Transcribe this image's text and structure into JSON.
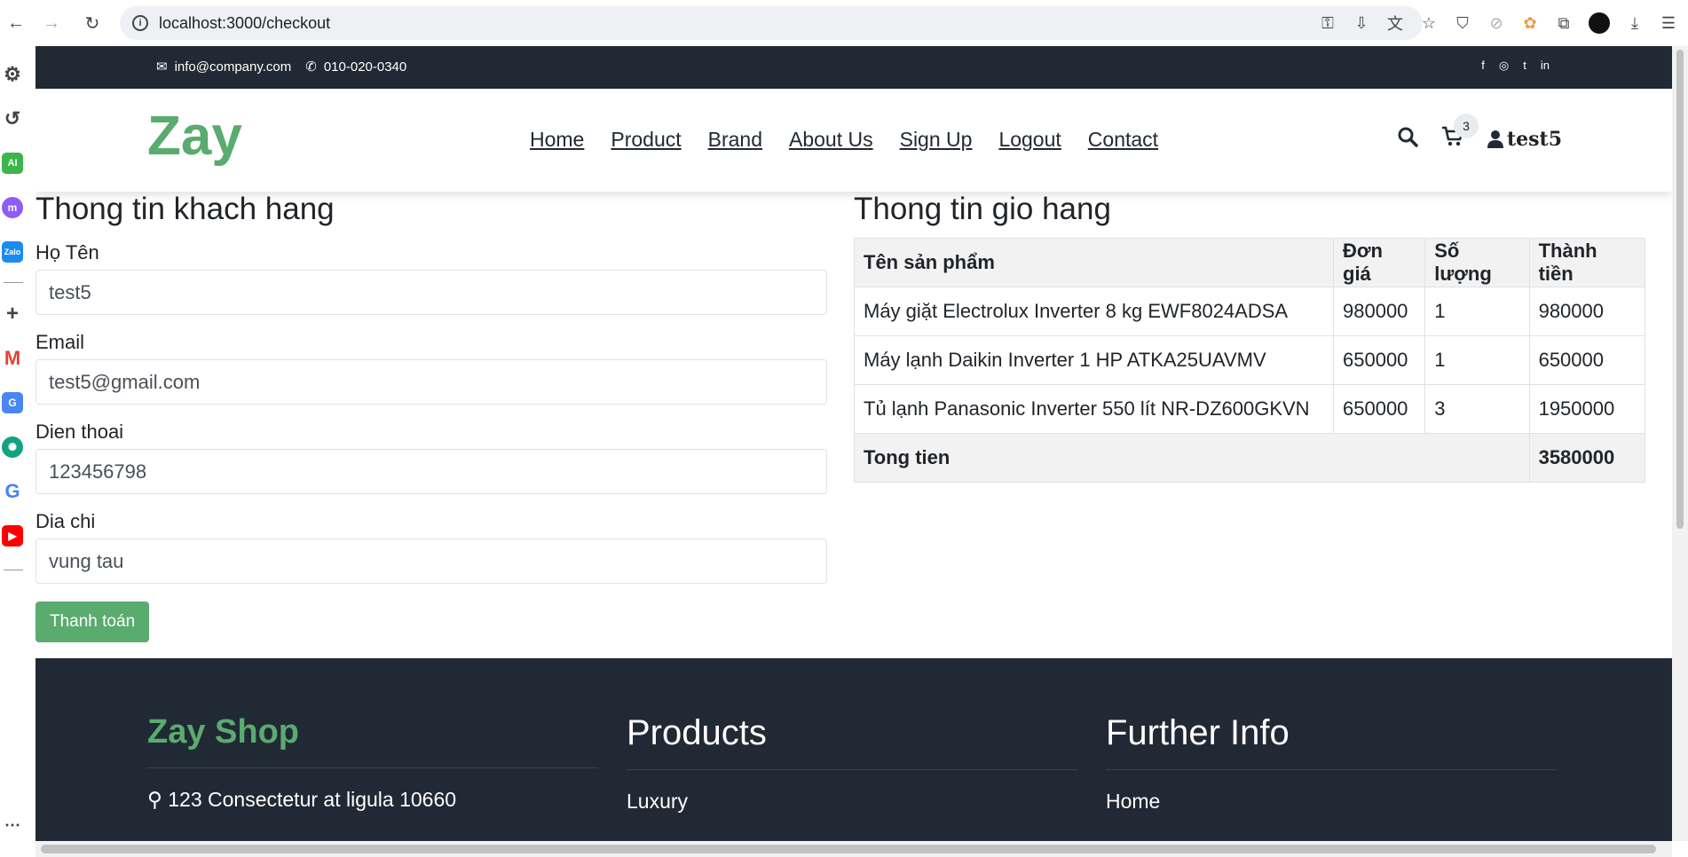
{
  "browser": {
    "url": "localhost:3000/checkout"
  },
  "topbar": {
    "email": "info@company.com",
    "phone": "010-020-0340",
    "socials": [
      "f",
      "◎",
      "t",
      "in"
    ]
  },
  "header": {
    "logo": "Zay",
    "menu": [
      "Home",
      "Product",
      "Brand",
      "About Us",
      "Sign Up",
      "Logout",
      "Contact"
    ],
    "cart_count": "3",
    "username": "test5"
  },
  "customer": {
    "title": "Thong tin khach hang",
    "fields": [
      {
        "label": "Họ Tên",
        "value": "test5"
      },
      {
        "label": "Email",
        "value": "test5@gmail.com"
      },
      {
        "label": "Dien thoai",
        "value": "123456798"
      },
      {
        "label": "Dia chi",
        "value": "vung tau"
      }
    ],
    "submit_label": "Thanh toán"
  },
  "cart": {
    "title": "Thong tin gio hang",
    "columns": [
      "Tên sản phẩm",
      "Đơn giá",
      "Số lượng",
      "Thành tiền"
    ],
    "rows": [
      [
        "Máy giặt Electrolux Inverter 8 kg EWF8024ADSA",
        "980000",
        "1",
        "980000"
      ],
      [
        "Máy lạnh Daikin Inverter 1 HP ATKA25UAVMV",
        "650000",
        "1",
        "650000"
      ],
      [
        "Tủ lạnh Panasonic Inverter 550 lít NR-DZ600GKVN",
        "650000",
        "3",
        "1950000"
      ]
    ],
    "total_label": "Tong tien",
    "total_value": "3580000"
  },
  "footer": {
    "col1_title": "Zay Shop",
    "col1_item": "123 Consectetur at ligula 10660",
    "col2_title": "Products",
    "col2_item": "Luxury",
    "col3_title": "Further Info",
    "col3_item": "Home"
  },
  "colors": {
    "brand": "#59ab6e",
    "dark": "#212934"
  }
}
